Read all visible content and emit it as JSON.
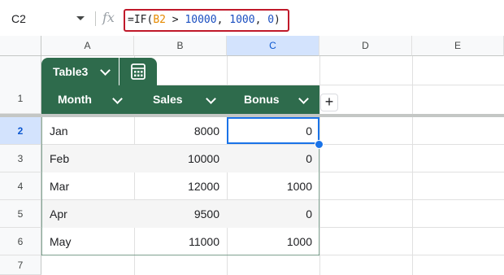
{
  "name_box": "C2",
  "formula": {
    "tokens": [
      {
        "text": "=IF(",
        "kind": "txt"
      },
      {
        "text": "B2",
        "kind": "ref"
      },
      {
        "text": " > ",
        "kind": "txt"
      },
      {
        "text": "10000",
        "kind": "num"
      },
      {
        "text": ", ",
        "kind": "txt"
      },
      {
        "text": "1000",
        "kind": "num"
      },
      {
        "text": ", ",
        "kind": "txt"
      },
      {
        "text": "0",
        "kind": "num"
      },
      {
        "text": ")",
        "kind": "txt"
      }
    ]
  },
  "fx_label": "fx",
  "columns": [
    "A",
    "B",
    "C",
    "D",
    "E"
  ],
  "selected_column": "C",
  "rows": [
    "1",
    "2",
    "3",
    "4",
    "5",
    "6",
    "7"
  ],
  "selected_row": "2",
  "table": {
    "name": "Table3",
    "headers": [
      "Month",
      "Sales",
      "Bonus"
    ],
    "data": [
      [
        "Jan",
        "8000",
        "0"
      ],
      [
        "Feb",
        "10000",
        "0"
      ],
      [
        "Mar",
        "12000",
        "1000"
      ],
      [
        "Apr",
        "9500",
        "0"
      ],
      [
        "May",
        "11000",
        "1000"
      ]
    ]
  },
  "add_column_label": "+",
  "colors": {
    "table_header": "#2e6b4c",
    "selection": "#1a73e8",
    "formula_highlight": "#c0192a"
  }
}
